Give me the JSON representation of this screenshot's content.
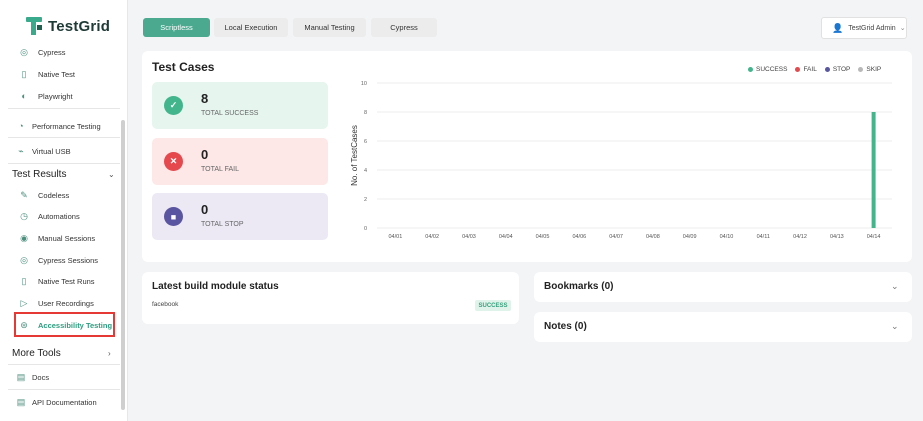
{
  "app": {
    "name": "TestGrid"
  },
  "sidebar": {
    "items": [
      {
        "label": "Cypress",
        "icon": "cypress-icon"
      },
      {
        "label": "Native Test",
        "icon": "native-test-icon"
      },
      {
        "label": "Playwright",
        "icon": "playwright-icon"
      },
      {
        "label": "Performance Testing",
        "icon": "performance-icon"
      },
      {
        "label": "Virtual USB",
        "icon": "usb-icon"
      }
    ],
    "test_results": {
      "label": "Test Results",
      "items": [
        {
          "label": "Codeless",
          "icon": "codeless-icon"
        },
        {
          "label": "Automations",
          "icon": "automations-icon"
        },
        {
          "label": "Manual Sessions",
          "icon": "manual-sessions-icon"
        },
        {
          "label": "Cypress Sessions",
          "icon": "cypress-sessions-icon"
        },
        {
          "label": "Native Test Runs",
          "icon": "native-test-runs-icon"
        },
        {
          "label": "User Recordings",
          "icon": "user-recordings-icon"
        },
        {
          "label": "Accessibility Testing",
          "icon": "accessibility-icon",
          "active": true
        }
      ]
    },
    "more_tools": {
      "label": "More Tools",
      "items": [
        {
          "label": "Docs",
          "icon": "docs-icon"
        },
        {
          "label": "API Documentation",
          "icon": "api-docs-icon"
        }
      ]
    }
  },
  "topbar": {
    "tabs": [
      {
        "label": "Scriptless",
        "active": true
      },
      {
        "label": "Local Execution",
        "active": false
      },
      {
        "label": "Manual Testing",
        "active": false
      },
      {
        "label": "Cypress",
        "active": false
      }
    ],
    "user": "TestGrid Admin"
  },
  "test_cases": {
    "title": "Test Cases",
    "stats": [
      {
        "value": "8",
        "label": "TOTAL SUCCESS",
        "color": "#43b58c",
        "bg": "#e6f6ef",
        "glyph": "✓"
      },
      {
        "value": "0",
        "label": "TOTAL FAIL",
        "color": "#e5484d",
        "bg": "#fde7e7",
        "glyph": "✕"
      },
      {
        "value": "0",
        "label": "TOTAL STOP",
        "color": "#5a55a0",
        "bg": "#ece9f5",
        "glyph": "■"
      }
    ]
  },
  "chart_data": {
    "type": "bar",
    "ylabel": "No. of TestCases",
    "ylim": [
      0,
      10
    ],
    "yticks": [
      "0",
      "2",
      "4",
      "6",
      "8",
      "10"
    ],
    "categories": [
      "04/01",
      "04/02",
      "04/03",
      "04/04",
      "04/05",
      "04/06",
      "04/07",
      "04/08",
      "04/09",
      "04/10",
      "04/11",
      "04/12",
      "04/13",
      "04/14"
    ],
    "series": [
      {
        "name": "SUCCESS",
        "color": "#43b58c",
        "values": [
          0,
          0,
          0,
          0,
          0,
          0,
          0,
          0,
          0,
          0,
          0,
          0,
          0,
          8
        ]
      },
      {
        "name": "FAIL",
        "color": "#e5484d",
        "values": [
          0,
          0,
          0,
          0,
          0,
          0,
          0,
          0,
          0,
          0,
          0,
          0,
          0,
          0
        ]
      },
      {
        "name": "STOP",
        "color": "#5a55a0",
        "values": [
          0,
          0,
          0,
          0,
          0,
          0,
          0,
          0,
          0,
          0,
          0,
          0,
          0,
          0
        ]
      },
      {
        "name": "SKIP",
        "color": "#b8b8b8",
        "values": [
          0,
          0,
          0,
          0,
          0,
          0,
          0,
          0,
          0,
          0,
          0,
          0,
          0,
          0
        ]
      }
    ],
    "grid": true,
    "legend": "top-right"
  },
  "build_status": {
    "title": "Latest build module status",
    "rows": [
      {
        "name": "facebook",
        "status": "SUCCESS"
      }
    ]
  },
  "bookmarks": {
    "title": "Bookmarks (0)"
  },
  "notes": {
    "title": "Notes (0)"
  }
}
